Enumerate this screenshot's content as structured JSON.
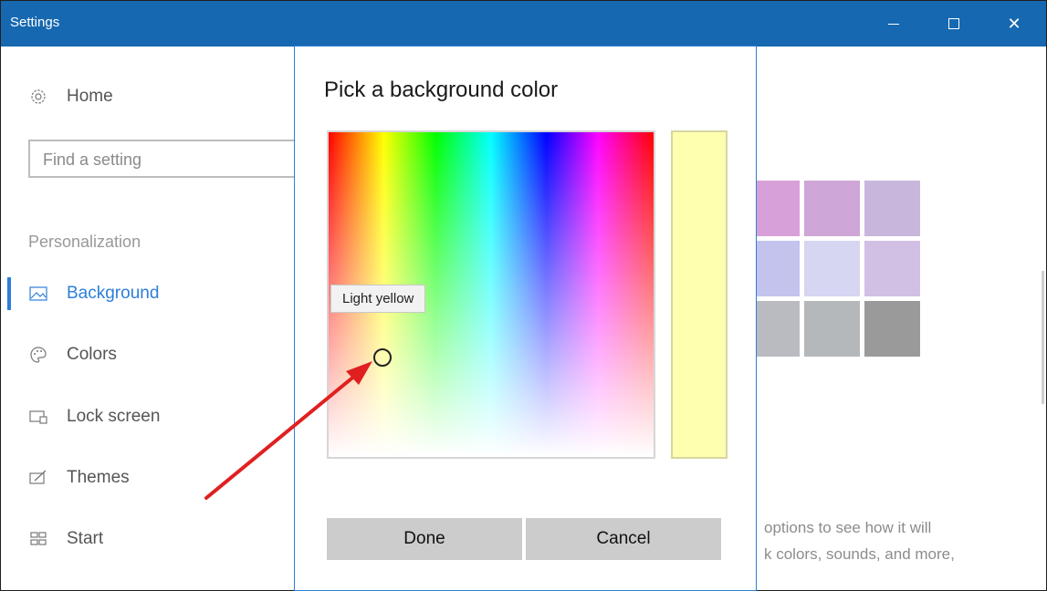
{
  "window": {
    "title": "Settings"
  },
  "sidebar": {
    "home_label": "Home",
    "search_placeholder": "Find a setting",
    "section_label": "Personalization",
    "items": [
      {
        "label": "Background",
        "icon": "picture-icon",
        "selected": true
      },
      {
        "label": "Colors",
        "icon": "palette-icon",
        "selected": false
      },
      {
        "label": "Lock screen",
        "icon": "lock-screen-icon",
        "selected": false
      },
      {
        "label": "Themes",
        "icon": "brush-icon",
        "selected": false
      },
      {
        "label": "Start",
        "icon": "start-grid-icon",
        "selected": false
      }
    ]
  },
  "main": {
    "swatch_colors": [
      [
        "#d8a0d8",
        "#cfa6d8",
        "#c9b6dc"
      ],
      [
        "#c3c3ee",
        "#d6d6f2",
        "#d2bfe4"
      ],
      [
        "#b9bbc0",
        "#b4b8bb",
        "#9a9a9a"
      ]
    ],
    "hint_line_1": "options to see how it will",
    "hint_line_2": "k colors, sounds, and more,"
  },
  "dialog": {
    "title": "Pick a background color",
    "tooltip": "Light yellow",
    "selected_color": "#ffffb0",
    "done_label": "Done",
    "cancel_label": "Cancel"
  },
  "colors": {
    "accent": "#2d7fd8",
    "titlebar": "#1668b0",
    "annotation_arrow": "#e02020"
  }
}
